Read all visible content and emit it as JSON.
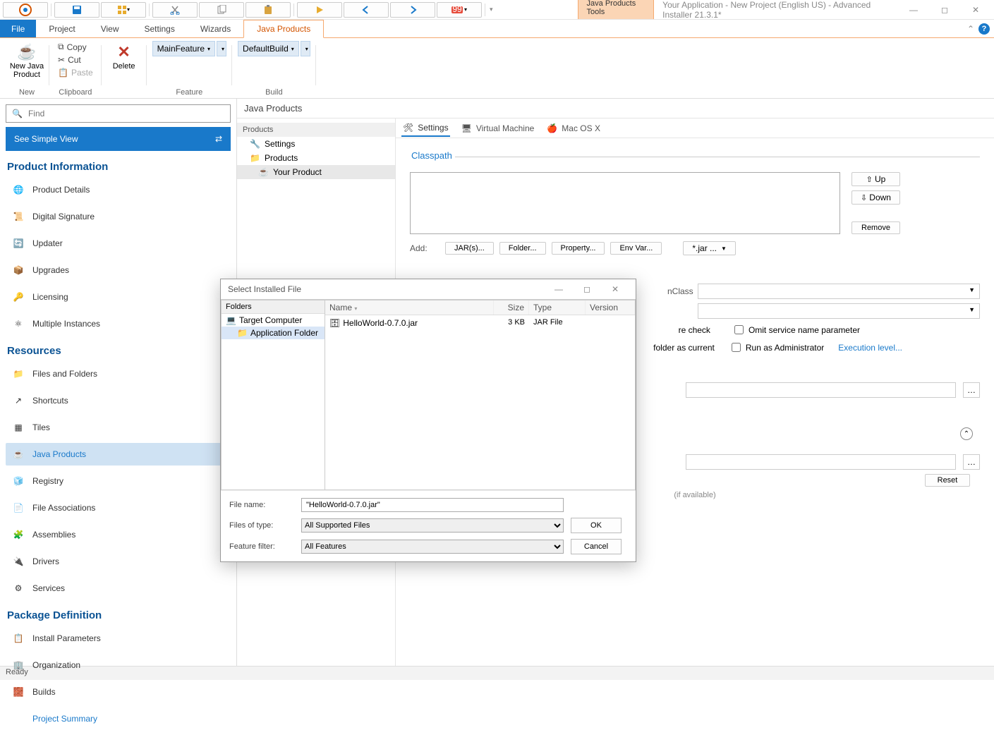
{
  "titlebar": {
    "ctx_tab": "Java Products Tools",
    "app_title": "Your Application - New Project (English US) - Advanced Installer 21.3.1*"
  },
  "ribbontabs": {
    "file": "File",
    "tabs": [
      "Project",
      "View",
      "Settings",
      "Wizards",
      "Java Products"
    ],
    "active_index": 4
  },
  "ribbon": {
    "new_group": {
      "big": "New Java\nProduct",
      "label": "New"
    },
    "clipboard_group": {
      "copy": "Copy",
      "cut": "Cut",
      "paste": "Paste",
      "label": "Clipboard"
    },
    "delete_group": {
      "delete": "Delete"
    },
    "feature_group": {
      "combo": "MainFeature",
      "label": "Feature"
    },
    "build_group": {
      "combo": "DefaultBuild",
      "label": "Build"
    }
  },
  "leftpanel": {
    "find_placeholder": "Find",
    "simple_view": "See Simple View",
    "sections": {
      "product_info": {
        "title": "Product Information",
        "items": [
          "Product Details",
          "Digital Signature",
          "Updater",
          "Upgrades",
          "Licensing",
          "Multiple Instances"
        ]
      },
      "resources": {
        "title": "Resources",
        "items": [
          "Files and Folders",
          "Shortcuts",
          "Tiles",
          "Java Products",
          "Registry",
          "File Associations",
          "Assemblies",
          "Drivers",
          "Services"
        ],
        "selected_index": 3
      },
      "package_def": {
        "title": "Package Definition",
        "items": [
          "Install Parameters",
          "Organization",
          "Builds",
          "Project Summary"
        ],
        "link_index": 3
      }
    }
  },
  "workarea": {
    "header": "Java Products",
    "tree": {
      "header": "Products",
      "items": [
        {
          "label": "Settings",
          "indent": 0,
          "icon": "wrench"
        },
        {
          "label": "Products",
          "indent": 0,
          "icon": "folder"
        },
        {
          "label": "Your Product",
          "indent": 1,
          "icon": "java",
          "selected": true
        }
      ]
    },
    "tabs": [
      "Settings",
      "Virtual Machine",
      "Mac OS X"
    ],
    "active_tab": 0,
    "classpath": {
      "title": "Classpath",
      "up": "Up",
      "down": "Down",
      "remove": "Remove",
      "add_label": "Add:",
      "buttons": [
        "JAR(s)...",
        "Folder...",
        "Property...",
        "Env Var..."
      ],
      "filter": "*.jar ..."
    },
    "form": {
      "class_suffix": "nClass",
      "signature_check_label": "re check",
      "omit": "Omit service name parameter",
      "folder_current_label": "folder as current",
      "run_admin": "Run as Administrator",
      "exec_level": "Execution level...",
      "reset": "Reset",
      "if_available": "(if available)"
    }
  },
  "dialog": {
    "title": "Select Installed File",
    "folders_hdr": "Folders",
    "tree": [
      {
        "label": "Target Computer",
        "indent": 0,
        "icon": "computer"
      },
      {
        "label": "Application Folder",
        "indent": 1,
        "icon": "folder",
        "selected": true
      }
    ],
    "columns": [
      "Name",
      "Size",
      "Type",
      "Version"
    ],
    "rows": [
      {
        "name": "HelloWorld-0.7.0.jar",
        "size": "3 KB",
        "type": "JAR File",
        "version": ""
      }
    ],
    "filename_label": "File name:",
    "filename_value": "\"HelloWorld-0.7.0.jar\"",
    "filetype_label": "Files of type:",
    "filetype_value": "All Supported Files",
    "featurefilter_label": "Feature filter:",
    "featurefilter_value": "All Features",
    "ok": "OK",
    "cancel": "Cancel"
  },
  "statusbar": {
    "text": "Ready"
  }
}
